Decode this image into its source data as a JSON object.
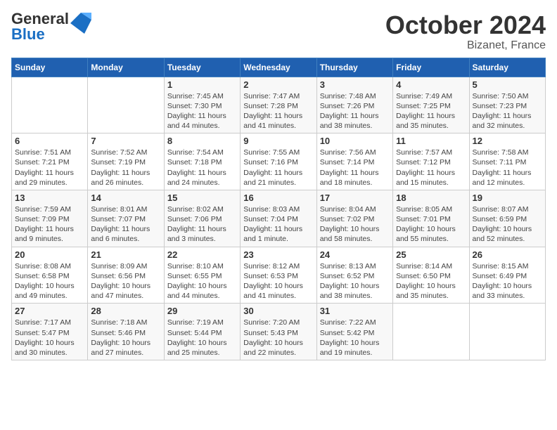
{
  "header": {
    "logo_general": "General",
    "logo_blue": "Blue",
    "month_title": "October 2024",
    "location": "Bizanet, France"
  },
  "columns": [
    "Sunday",
    "Monday",
    "Tuesday",
    "Wednesday",
    "Thursday",
    "Friday",
    "Saturday"
  ],
  "weeks": [
    [
      {
        "day": "",
        "sunrise": "",
        "sunset": "",
        "daylight": ""
      },
      {
        "day": "",
        "sunrise": "",
        "sunset": "",
        "daylight": ""
      },
      {
        "day": "1",
        "sunrise": "Sunrise: 7:45 AM",
        "sunset": "Sunset: 7:30 PM",
        "daylight": "Daylight: 11 hours and 44 minutes."
      },
      {
        "day": "2",
        "sunrise": "Sunrise: 7:47 AM",
        "sunset": "Sunset: 7:28 PM",
        "daylight": "Daylight: 11 hours and 41 minutes."
      },
      {
        "day": "3",
        "sunrise": "Sunrise: 7:48 AM",
        "sunset": "Sunset: 7:26 PM",
        "daylight": "Daylight: 11 hours and 38 minutes."
      },
      {
        "day": "4",
        "sunrise": "Sunrise: 7:49 AM",
        "sunset": "Sunset: 7:25 PM",
        "daylight": "Daylight: 11 hours and 35 minutes."
      },
      {
        "day": "5",
        "sunrise": "Sunrise: 7:50 AM",
        "sunset": "Sunset: 7:23 PM",
        "daylight": "Daylight: 11 hours and 32 minutes."
      }
    ],
    [
      {
        "day": "6",
        "sunrise": "Sunrise: 7:51 AM",
        "sunset": "Sunset: 7:21 PM",
        "daylight": "Daylight: 11 hours and 29 minutes."
      },
      {
        "day": "7",
        "sunrise": "Sunrise: 7:52 AM",
        "sunset": "Sunset: 7:19 PM",
        "daylight": "Daylight: 11 hours and 26 minutes."
      },
      {
        "day": "8",
        "sunrise": "Sunrise: 7:54 AM",
        "sunset": "Sunset: 7:18 PM",
        "daylight": "Daylight: 11 hours and 24 minutes."
      },
      {
        "day": "9",
        "sunrise": "Sunrise: 7:55 AM",
        "sunset": "Sunset: 7:16 PM",
        "daylight": "Daylight: 11 hours and 21 minutes."
      },
      {
        "day": "10",
        "sunrise": "Sunrise: 7:56 AM",
        "sunset": "Sunset: 7:14 PM",
        "daylight": "Daylight: 11 hours and 18 minutes."
      },
      {
        "day": "11",
        "sunrise": "Sunrise: 7:57 AM",
        "sunset": "Sunset: 7:12 PM",
        "daylight": "Daylight: 11 hours and 15 minutes."
      },
      {
        "day": "12",
        "sunrise": "Sunrise: 7:58 AM",
        "sunset": "Sunset: 7:11 PM",
        "daylight": "Daylight: 11 hours and 12 minutes."
      }
    ],
    [
      {
        "day": "13",
        "sunrise": "Sunrise: 7:59 AM",
        "sunset": "Sunset: 7:09 PM",
        "daylight": "Daylight: 11 hours and 9 minutes."
      },
      {
        "day": "14",
        "sunrise": "Sunrise: 8:01 AM",
        "sunset": "Sunset: 7:07 PM",
        "daylight": "Daylight: 11 hours and 6 minutes."
      },
      {
        "day": "15",
        "sunrise": "Sunrise: 8:02 AM",
        "sunset": "Sunset: 7:06 PM",
        "daylight": "Daylight: 11 hours and 3 minutes."
      },
      {
        "day": "16",
        "sunrise": "Sunrise: 8:03 AM",
        "sunset": "Sunset: 7:04 PM",
        "daylight": "Daylight: 11 hours and 1 minute."
      },
      {
        "day": "17",
        "sunrise": "Sunrise: 8:04 AM",
        "sunset": "Sunset: 7:02 PM",
        "daylight": "Daylight: 10 hours and 58 minutes."
      },
      {
        "day": "18",
        "sunrise": "Sunrise: 8:05 AM",
        "sunset": "Sunset: 7:01 PM",
        "daylight": "Daylight: 10 hours and 55 minutes."
      },
      {
        "day": "19",
        "sunrise": "Sunrise: 8:07 AM",
        "sunset": "Sunset: 6:59 PM",
        "daylight": "Daylight: 10 hours and 52 minutes."
      }
    ],
    [
      {
        "day": "20",
        "sunrise": "Sunrise: 8:08 AM",
        "sunset": "Sunset: 6:58 PM",
        "daylight": "Daylight: 10 hours and 49 minutes."
      },
      {
        "day": "21",
        "sunrise": "Sunrise: 8:09 AM",
        "sunset": "Sunset: 6:56 PM",
        "daylight": "Daylight: 10 hours and 47 minutes."
      },
      {
        "day": "22",
        "sunrise": "Sunrise: 8:10 AM",
        "sunset": "Sunset: 6:55 PM",
        "daylight": "Daylight: 10 hours and 44 minutes."
      },
      {
        "day": "23",
        "sunrise": "Sunrise: 8:12 AM",
        "sunset": "Sunset: 6:53 PM",
        "daylight": "Daylight: 10 hours and 41 minutes."
      },
      {
        "day": "24",
        "sunrise": "Sunrise: 8:13 AM",
        "sunset": "Sunset: 6:52 PM",
        "daylight": "Daylight: 10 hours and 38 minutes."
      },
      {
        "day": "25",
        "sunrise": "Sunrise: 8:14 AM",
        "sunset": "Sunset: 6:50 PM",
        "daylight": "Daylight: 10 hours and 35 minutes."
      },
      {
        "day": "26",
        "sunrise": "Sunrise: 8:15 AM",
        "sunset": "Sunset: 6:49 PM",
        "daylight": "Daylight: 10 hours and 33 minutes."
      }
    ],
    [
      {
        "day": "27",
        "sunrise": "Sunrise: 7:17 AM",
        "sunset": "Sunset: 5:47 PM",
        "daylight": "Daylight: 10 hours and 30 minutes."
      },
      {
        "day": "28",
        "sunrise": "Sunrise: 7:18 AM",
        "sunset": "Sunset: 5:46 PM",
        "daylight": "Daylight: 10 hours and 27 minutes."
      },
      {
        "day": "29",
        "sunrise": "Sunrise: 7:19 AM",
        "sunset": "Sunset: 5:44 PM",
        "daylight": "Daylight: 10 hours and 25 minutes."
      },
      {
        "day": "30",
        "sunrise": "Sunrise: 7:20 AM",
        "sunset": "Sunset: 5:43 PM",
        "daylight": "Daylight: 10 hours and 22 minutes."
      },
      {
        "day": "31",
        "sunrise": "Sunrise: 7:22 AM",
        "sunset": "Sunset: 5:42 PM",
        "daylight": "Daylight: 10 hours and 19 minutes."
      },
      {
        "day": "",
        "sunrise": "",
        "sunset": "",
        "daylight": ""
      },
      {
        "day": "",
        "sunrise": "",
        "sunset": "",
        "daylight": ""
      }
    ]
  ]
}
